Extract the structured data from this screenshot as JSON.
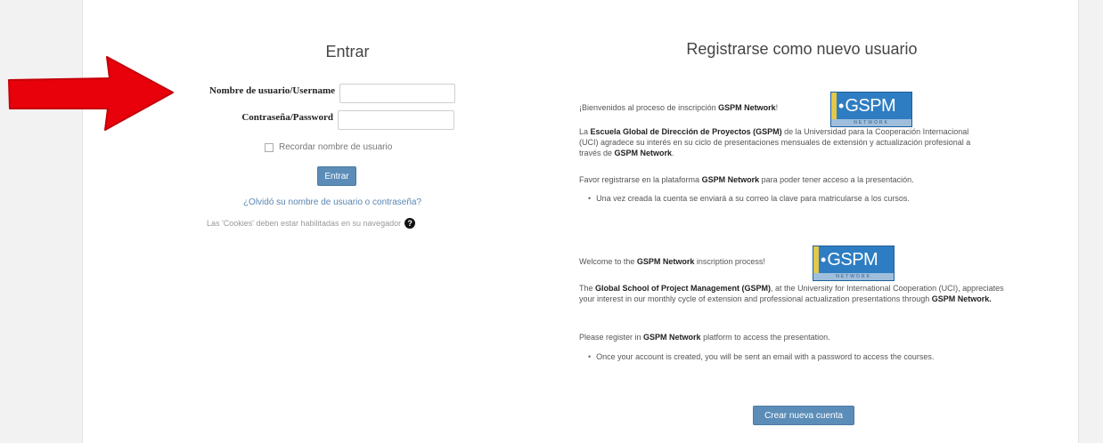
{
  "login": {
    "title": "Entrar",
    "username_label": "Nombre de usuario/Username",
    "password_label": "Contraseña/Password",
    "remember_label": "Recordar nombre de usuario",
    "submit_label": "Entrar",
    "forgot_link": "¿Olvidó su nombre de usuario o contraseña?",
    "cookies_notice": "Las 'Cookies' deben estar habilitadas en su navegador",
    "username_value": "",
    "password_value": ""
  },
  "register": {
    "title": "Registrarse como nuevo usuario",
    "logo_text": "GSPM",
    "logo_subtext": "NETWORK",
    "es": {
      "welcome_prefix": "¡Bienvenidos al proceso de inscripción ",
      "welcome_brand": "GSPM Network",
      "welcome_suffix": "!",
      "intro_pre": "La ",
      "intro_school": "Escuela Global de Dirección de Proyectos (GSPM)",
      "intro_mid": " de la Universidad para la Cooperación Internacional (UCI) agradece su interés en su ciclo de presentaciones mensuales de extensión y actualización profesional a través de ",
      "intro_brand": "GSPM Network",
      "intro_end": ".",
      "register_pre": "Favor registrarse en la plataforma ",
      "register_brand": "GSPM Network",
      "register_end": " para poder tener acceso a la presentación.",
      "bullet": "Una vez creada la cuenta se enviará a su correo la clave para matricularse a los cursos."
    },
    "en": {
      "welcome_prefix": "Welcome to the ",
      "welcome_brand": "GSPM Network",
      "welcome_suffix": " inscription process!",
      "intro_pre": "The ",
      "intro_school": "Global School of Project Management (GSPM)",
      "intro_mid": ", at the University for International Cooperation (UCI), appreciates your interest in our monthly cycle of extension and professional actualization presentations through ",
      "intro_brand": "GSPM Network.",
      "register_pre": "Please register in ",
      "register_brand": "GSPM Network",
      "register_end": " platform to access the presentation.",
      "bullet": "Once your account is created, you will be sent an email with a password to access the courses."
    },
    "create_button": "Crear nueva cuenta"
  },
  "colors": {
    "button": "#5b8db8",
    "link": "#5b86b3",
    "arrow": "#e8000b",
    "logo": "#2e7dc2"
  },
  "icons": [
    "help-icon",
    "red-arrow"
  ]
}
